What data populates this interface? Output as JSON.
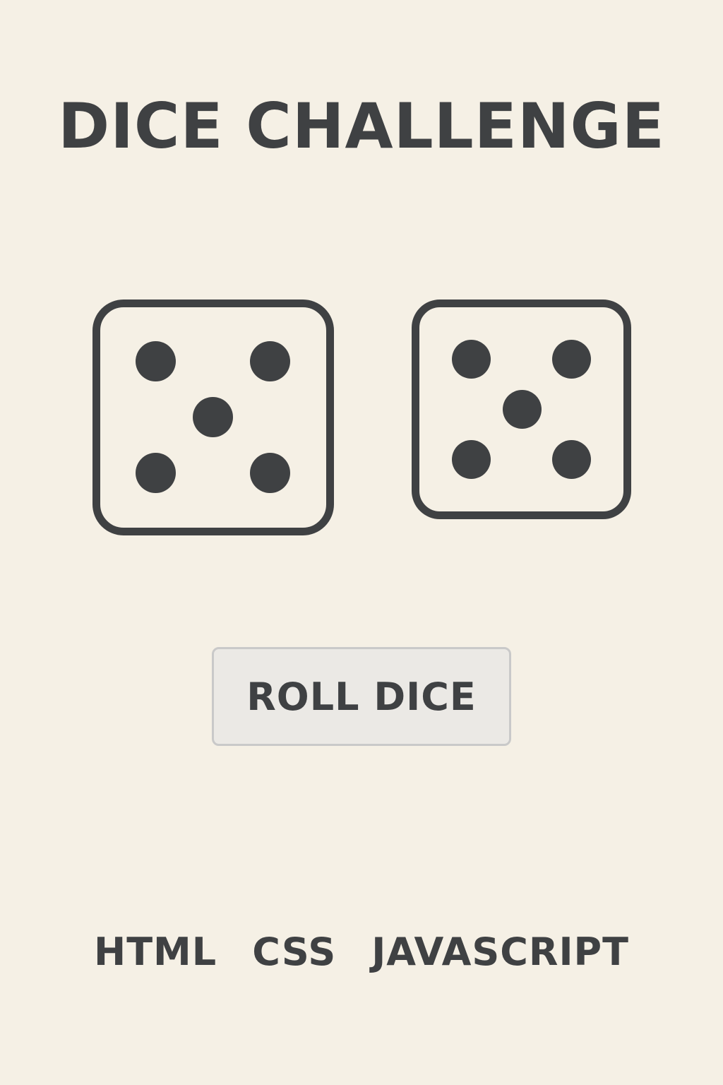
{
  "header": {
    "title": "DICE CHALLENGE"
  },
  "dice": [
    {
      "value": 5
    },
    {
      "value": 5
    }
  ],
  "controls": {
    "roll_label": "ROLL DICE"
  },
  "footer": {
    "tech": [
      "HTML",
      "CSS",
      "JAVASCRIPT"
    ]
  },
  "colors": {
    "background": "#f5f0e5",
    "ink": "#3f4143",
    "button_bg": "#ebe9e5",
    "button_border": "#c9c9c9"
  }
}
